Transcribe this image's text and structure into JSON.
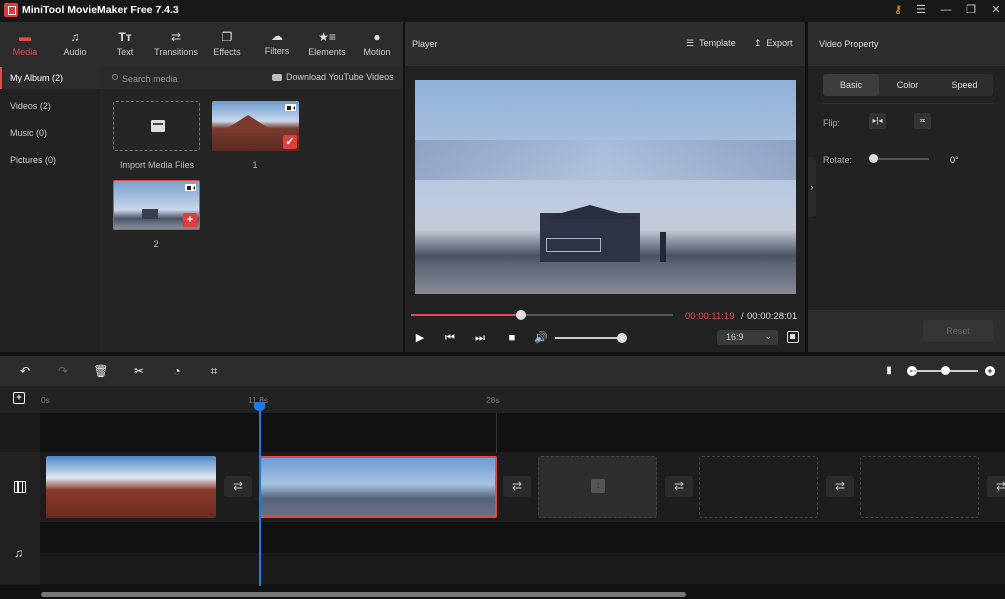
{
  "app": {
    "title": "MiniTool MovieMaker Free 7.4.3"
  },
  "window_controls": {
    "key": "key-icon",
    "menu": "menu-icon",
    "minimize": "minimize-icon",
    "restore": "restore-icon",
    "close": "close-icon"
  },
  "tabs": [
    {
      "label": "Media",
      "icon": "folder-icon",
      "active": true
    },
    {
      "label": "Audio",
      "icon": "music-icon"
    },
    {
      "label": "Text",
      "icon": "text-icon"
    },
    {
      "label": "Transitions",
      "icon": "transitions-icon"
    },
    {
      "label": "Effects",
      "icon": "effects-icon"
    },
    {
      "label": "Filters",
      "icon": "filters-icon"
    },
    {
      "label": "Elements",
      "icon": "elements-icon"
    },
    {
      "label": "Motion",
      "icon": "motion-icon"
    }
  ],
  "album_nav": [
    {
      "label": "My Album (2)",
      "active": true
    },
    {
      "label": "Videos (2)"
    },
    {
      "label": "Music (0)"
    },
    {
      "label": "Pictures (0)"
    }
  ],
  "search": {
    "placeholder": "Search media",
    "value": ""
  },
  "download_link": "Download YouTube Videos",
  "media": {
    "import_label": "Import Media Files",
    "items": [
      {
        "label": "1",
        "badge": "check",
        "selected": false
      },
      {
        "label": "2",
        "badge": "+",
        "selected": true
      }
    ]
  },
  "player": {
    "title": "Player",
    "template_label": "Template",
    "export_label": "Export",
    "time_current": "00:00:11:19",
    "time_separator": "/",
    "time_total": "00:00:28:01",
    "progress": 0.42,
    "volume": 1.0,
    "aspect_ratio": "16:9"
  },
  "property": {
    "title": "Video Property",
    "tabs": [
      {
        "label": "Basic",
        "active": true
      },
      {
        "label": "Color"
      },
      {
        "label": "Speed"
      }
    ],
    "flip_label": "Flip:",
    "rotate_label": "Rotate:",
    "rotate_value": "0°",
    "reset_label": "Reset"
  },
  "timeline": {
    "ticks": [
      "0s",
      "11.8s",
      "28s"
    ],
    "playhead_time": "11.8s",
    "zoom": 0.5,
    "clips": [
      {
        "name": "clip-1",
        "frames": 3
      },
      {
        "name": "clip-2",
        "frames": 4,
        "selected": true
      }
    ]
  },
  "colors": {
    "accent": "#e24b4b",
    "playhead": "#1e7be0"
  }
}
